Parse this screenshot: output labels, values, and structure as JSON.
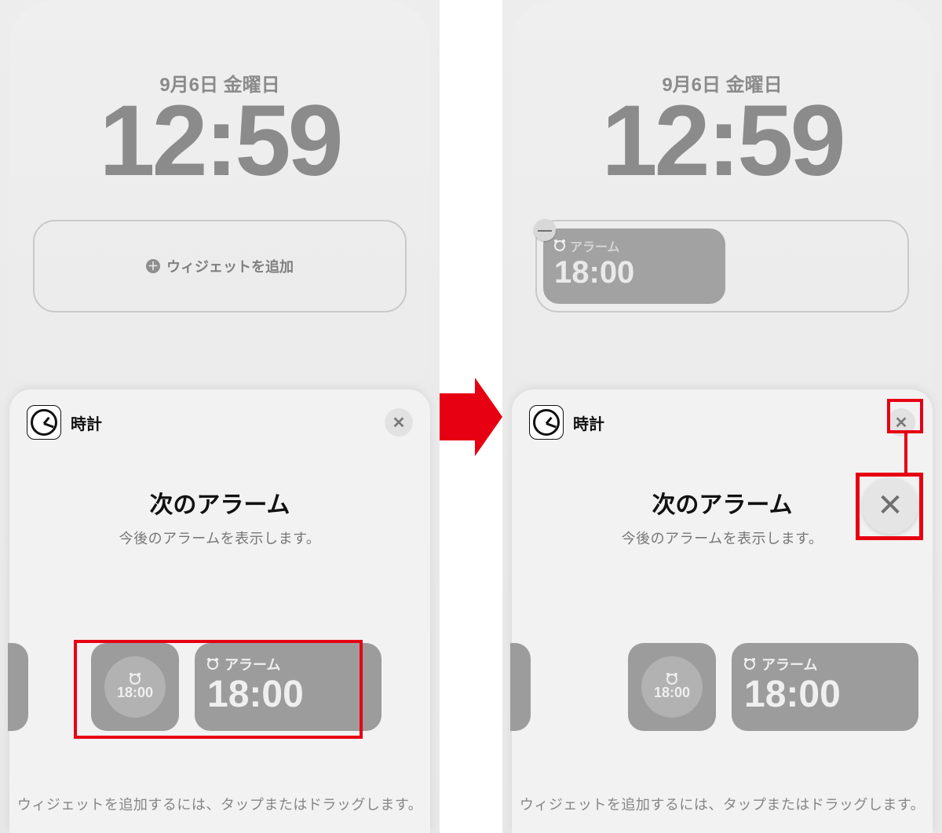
{
  "lock": {
    "date": "9月6日 金曜日",
    "time": "12:59"
  },
  "add_widget_label": "ウィジェットを追加",
  "placed_widget": {
    "label": "アラーム",
    "time": "18:00"
  },
  "sheet": {
    "app_name": "時計",
    "title": "次のアラーム",
    "subtitle": "今後のアラームを表示します。",
    "hint": "ウィジェットを追加するには、タップまたはドラッグします。"
  },
  "widgets": {
    "small_time": "18:00",
    "wide_label": "アラーム",
    "wide_time": "18:00"
  },
  "icons": {
    "close": "✕",
    "plus": "＋",
    "minus": "—"
  }
}
